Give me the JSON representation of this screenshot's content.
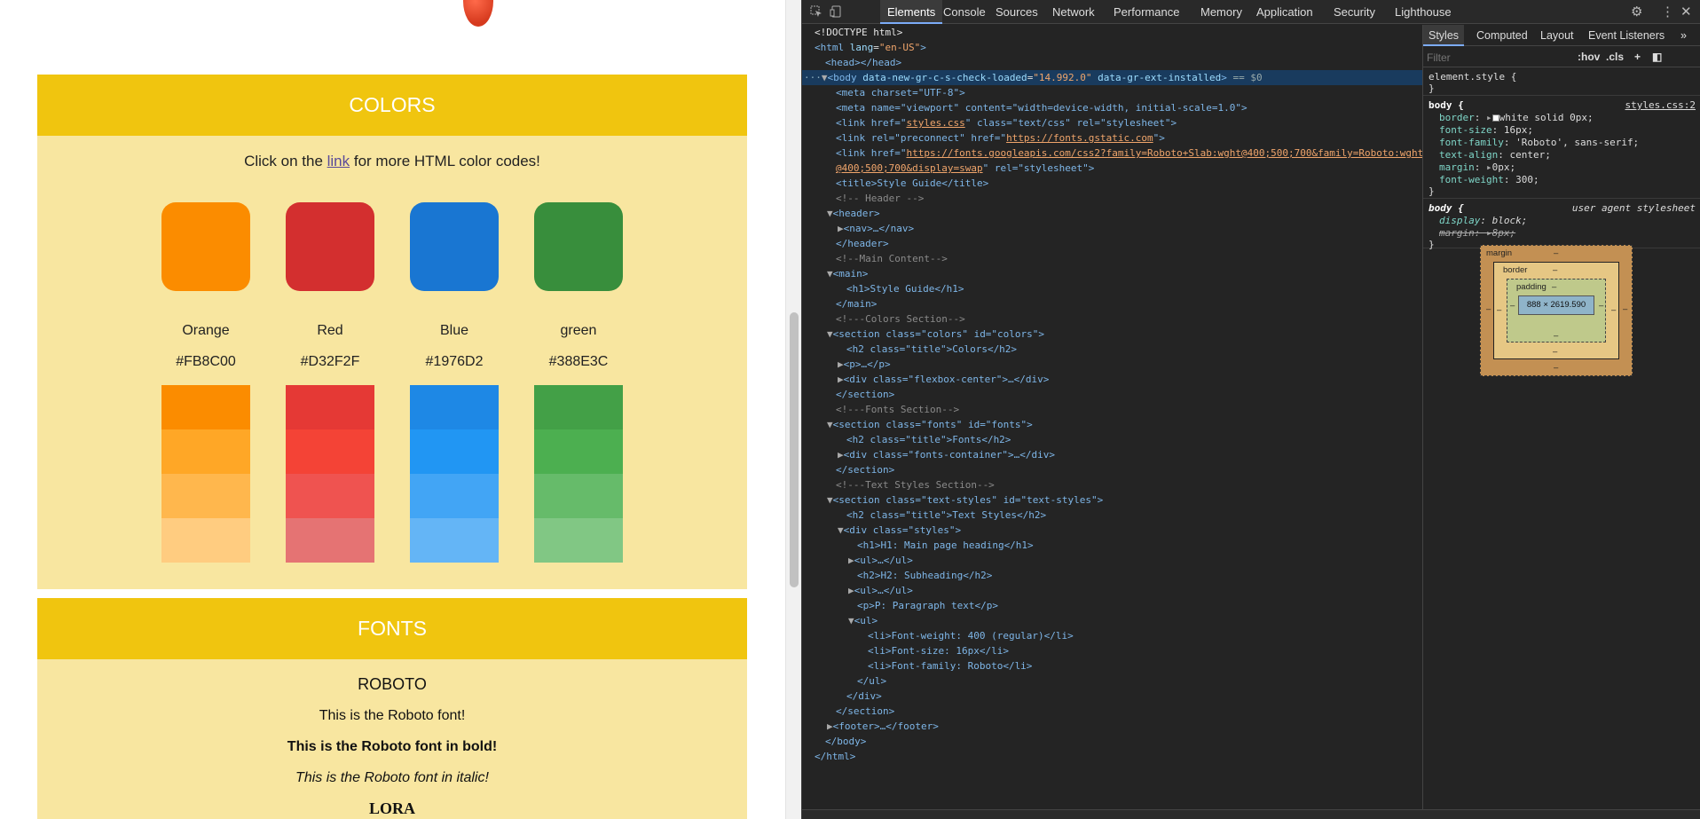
{
  "page": {
    "colors_title": "COLORS",
    "intro_before": "Click on the ",
    "intro_link": "link",
    "intro_after": " for more HTML color codes!",
    "swatches": [
      {
        "name": "Orange",
        "hex": "#FB8C00",
        "color": "#FB8C00",
        "shades": [
          "#FB8C00",
          "#FFA726",
          "#FFB74D",
          "#FFCC80"
        ]
      },
      {
        "name": "Red",
        "hex": "#D32F2F",
        "color": "#D32F2F",
        "shades": [
          "#E53935",
          "#F44336",
          "#EF5350",
          "#E57373"
        ]
      },
      {
        "name": "Blue",
        "hex": "#1976D2",
        "color": "#1976D2",
        "shades": [
          "#1E88E5",
          "#2196F3",
          "#42A5F5",
          "#64B5F6"
        ]
      },
      {
        "name": "green",
        "hex": "#388E3C",
        "color": "#388E3C",
        "shades": [
          "#43A047",
          "#4CAF50",
          "#66BB6A",
          "#81C784"
        ]
      }
    ],
    "fonts_title": "FONTS",
    "font_name": "ROBOTO",
    "font_line1": "This is the Roboto font!",
    "font_line2": "This is the Roboto font in bold!",
    "font_line3": "This is the Roboto font in italic!",
    "font_next": "LORA"
  },
  "devtools": {
    "tabs": [
      "Elements",
      "Console",
      "Sources",
      "Network",
      "Performance",
      "Memory",
      "Application",
      "Security",
      "Lighthouse"
    ],
    "active_tab": "Elements",
    "more_tabs": "»",
    "styles_tabs": [
      "Styles",
      "Computed",
      "Layout",
      "Event Listeners"
    ],
    "styles_more": "»",
    "filter_placeholder": "Filter",
    "hov": ":hov",
    "cls": ".cls",
    "tree": {
      "doctype": "<!DOCTYPE html>",
      "html_open": "html",
      "html_attr": "lang",
      "html_val": "\"en-US\"",
      "head": "<head></head>",
      "body_line": {
        "tag": "body",
        "a1": "data-new-gr-c-s-check-loaded",
        "v1": "\"14.992.0\"",
        "a2": "data-gr-ext-installed",
        "suffix": "== $0"
      },
      "meta1": "<meta charset=\"UTF-8\">",
      "meta2": "<meta name=\"viewport\" content=\"width=device-width, initial-scale=1.0\">",
      "link1_pre": "<link href=\"",
      "link1_url": "styles.css",
      "link1_post": "\" class=\"text/css\" rel=\"stylesheet\">",
      "link2_pre": "<link rel=\"preconnect\" href=\"",
      "link2_url": "https://fonts.gstatic.com",
      "link2_post": "\">",
      "link3_pre": "<link href=\"",
      "link3_url": "https://fonts.googleapis.com/css2?family=Roboto+Slab:wght@400;500;700&family=Roboto:wght",
      "link3_url2": "@400;500;700&display=swap",
      "link3_post": "\" rel=\"stylesheet\">",
      "title": "<title>Style Guide</title>",
      "c_header": "<!-- Header -->",
      "header_open": "<header>",
      "nav": "<nav>…</nav>",
      "header_close": "</header>",
      "c_main": "<!--Main Content-->",
      "main_open": "<main>",
      "h1": "<h1>Style Guide</h1>",
      "main_close": "</main>",
      "c_colors": "<!---Colors Section-->",
      "sec_colors": "<section class=\"colors\" id=\"colors\">",
      "h2_colors": "<h2 class=\"title\">Colors</h2>",
      "p_colors": "<p>…</p>",
      "div_flex": "<div class=\"flexbox-center\">…</div>",
      "sec_close1": "</section>",
      "c_fonts": "<!---Fonts Section-->",
      "sec_fonts": "<section class=\"fonts\" id=\"fonts\">",
      "h2_fonts": "<h2 class=\"title\">Fonts</h2>",
      "div_fonts": "<div class=\"fonts-container\">…</div>",
      "sec_close2": "</section>",
      "c_text": "<!---Text Styles Section-->",
      "sec_text": "<section class=\"text-styles\" id=\"text-styles\">",
      "h2_text": "<h2 class=\"title\">Text Styles</h2>",
      "div_styles": "<div class=\"styles\">",
      "h1_main": "<h1>H1: Main page heading</h1>",
      "ul1": "<ul>…</ul>",
      "h2_sub": "<h2>H2: Subheading</h2>",
      "ul2": "<ul>…</ul>",
      "p_para": "<p>P: Paragraph text</p>",
      "ul_open": "<ul>",
      "li1": "<li>Font-weight: 400 (regular)</li>",
      "li2": "<li>Font-size: 16px</li>",
      "li3": "<li>Font-family: Roboto</li>",
      "ul_close": "</ul>",
      "div_close": "</div>",
      "sec_close3": "</section>",
      "footer": "<footer>…</footer>",
      "body_close": "</body>",
      "html_close": "</html>"
    },
    "styles": {
      "element_style": "element.style {",
      "close": "}",
      "body_sel": "body {",
      "body_src": "styles.css:2",
      "props": [
        {
          "name": "border",
          "value": "white solid 0px;"
        },
        {
          "name": "font-size",
          "value": "16px;"
        },
        {
          "name": "font-family",
          "value": "'Roboto', sans-serif;"
        },
        {
          "name": "text-align",
          "value": "center;"
        },
        {
          "name": "margin",
          "value": "0px;"
        },
        {
          "name": "font-weight",
          "value": "300;"
        }
      ],
      "ua_sel": "body {",
      "ua_src": "user agent stylesheet",
      "ua_props": [
        {
          "name": "display",
          "value": "block;"
        },
        {
          "name": "margin",
          "value": "8px;"
        }
      ]
    },
    "box_model": {
      "margin": "margin",
      "border": "border",
      "padding": "padding",
      "content": "888 × 2619.590",
      "dash": "–"
    }
  }
}
